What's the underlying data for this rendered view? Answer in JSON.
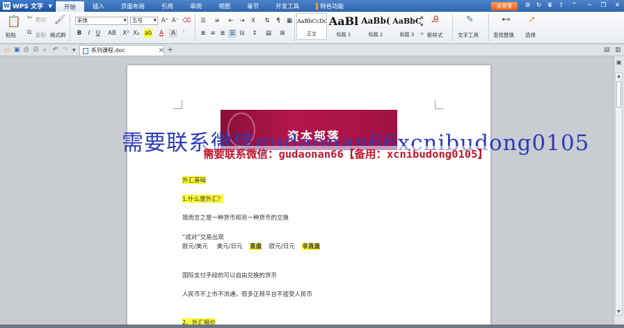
{
  "app": {
    "name": "WPS 文字",
    "logo": "W"
  },
  "menu": {
    "tabs": [
      "开始",
      "插入",
      "页面布局",
      "引用",
      "审阅",
      "视图",
      "章节",
      "开发工具",
      "特色功能"
    ],
    "login": "未登录"
  },
  "ribbon": {
    "paste": "粘贴",
    "cut": "剪切",
    "copy": "复制",
    "format_painter": "格式刷",
    "font_name": "宋体",
    "font_size": "五号",
    "styles": [
      {
        "sample": "AaBbCcDd",
        "label": "正文"
      },
      {
        "sample": "AaBl",
        "label": "标题 1"
      },
      {
        "sample": "AaBb(",
        "label": "标题 2"
      },
      {
        "sample": "AaBbC",
        "label": "标题 3"
      }
    ],
    "new_style": "新样式",
    "text_tools": "文字工具",
    "find_replace": "查找替换",
    "select": "选择"
  },
  "doc_tab": {
    "name": "系列课程.doc"
  },
  "document": {
    "banner_title": "资本部落",
    "lines": [
      "外汇基础",
      "1.什么是外汇？",
      "简而言之是一种货币和另一种货币的交换",
      "“成对”交易出现",
      "欧元/美元",
      "美元/日元",
      "直盘",
      "欧元/日元",
      "非直盘",
      "国际支付手段的可以自由兑换的货币",
      "人民币不上市不流通，很多正规平台不接受人民币",
      "2、外汇报价"
    ]
  },
  "watermark": {
    "line1": "需要联系微信gudaonan66xcnibudong0105",
    "line2": "需要联系微信：gudaonan66【备用：xcnibudong0105】"
  }
}
